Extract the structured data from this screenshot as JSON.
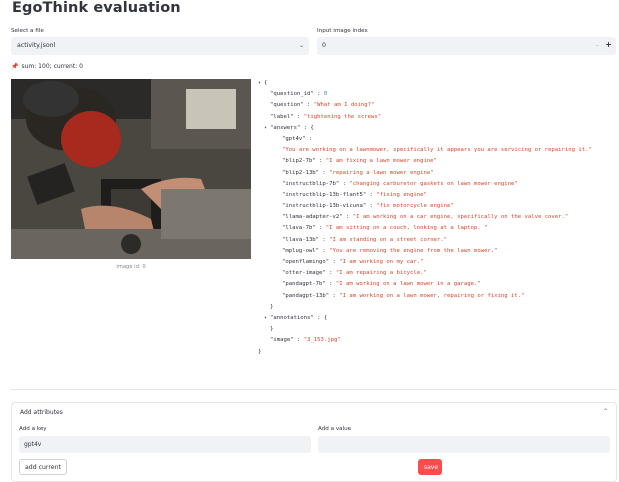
{
  "app": {
    "title": "EgoThink evaluation"
  },
  "file_select": {
    "label": "Select a file",
    "value": "activity.jsonl"
  },
  "index_input": {
    "label": "Input image index",
    "value": "0"
  },
  "status": {
    "text": "sum: 100; current: 0"
  },
  "image": {
    "caption": "image id: 0"
  },
  "json_view": {
    "open": "{",
    "close": "}",
    "question_id": {
      "key": "\"question_id\" : ",
      "value": "0"
    },
    "question": {
      "key": "\"question\" : ",
      "value": "\"What am I doing?\""
    },
    "label": {
      "key": "\"label\" : ",
      "value": "\"tightening the screws\""
    },
    "answers_key": "\"answers\" : {",
    "answers_close": "}",
    "gpt4v": {
      "key": "\"gpt4v\" :",
      "value": "\"You are working on a lawnmower, specifically it appears you are servicing or repairing it.\""
    },
    "answers": [
      {
        "key": "\"blip2-7b\" : ",
        "value": "\"I am fixing a lawn mower engine\""
      },
      {
        "key": "\"blip2-13b\" : ",
        "value": "\"repairing a lawn mower engine\""
      },
      {
        "key": "\"instructblip-7b\" : ",
        "value": "\"changing carburetor gaskets on lawn mower engine\""
      },
      {
        "key": "\"instructblip-13b-flant5\" : ",
        "value": "\"fixing engine\""
      },
      {
        "key": "\"instructblip-13b-vicuna\" : ",
        "value": "\"fix motorcycle engine\""
      },
      {
        "key": "\"llama-adapter-v2\" : ",
        "value": "\"I am working on a car engine, specifically on the valve cover.\""
      },
      {
        "key": "\"llava-7b\" : ",
        "value": "\"I am sitting on a couch, looking at a laptop. \""
      },
      {
        "key": "\"llava-13b\" : ",
        "value": "\"I am standing on a street corner.\""
      },
      {
        "key": "\"mplug-owl\" : ",
        "value": "\"You are removing the engine from the lawn mower.\""
      },
      {
        "key": "\"openflamingo\" : ",
        "value": "\"I am working on my car.\""
      },
      {
        "key": "\"otter-image\" : ",
        "value": "\"I am repairing a bicycle.\""
      },
      {
        "key": "\"pandagpt-7b\" : ",
        "value": "\"I am working on a lawn mower in a garage.\""
      },
      {
        "key": "\"pandagpt-13b\" : ",
        "value": "\"I am working on a lawn mower, repairing or fixing it.\""
      }
    ],
    "annotations_key": "\"annotations\" : {",
    "annotations_close": "}",
    "image_field": {
      "key": "\"image\" : ",
      "value": "\"3_153.jpg\""
    }
  },
  "add_attributes": {
    "title": "Add attributes",
    "key_label": "Add a key",
    "key_value": "gpt4v",
    "value_label": "Add a value",
    "value_value": "",
    "add_button": "add current",
    "save_button": "save"
  },
  "colors": {
    "accent": "#ff4b4b",
    "string": "#d6452b",
    "number": "#3d7bd9",
    "input_bg": "#f0f2f6"
  },
  "icons": {
    "status": "pin-icon",
    "select": "chevron-down-icon",
    "expander": "chevron-up-icon"
  }
}
